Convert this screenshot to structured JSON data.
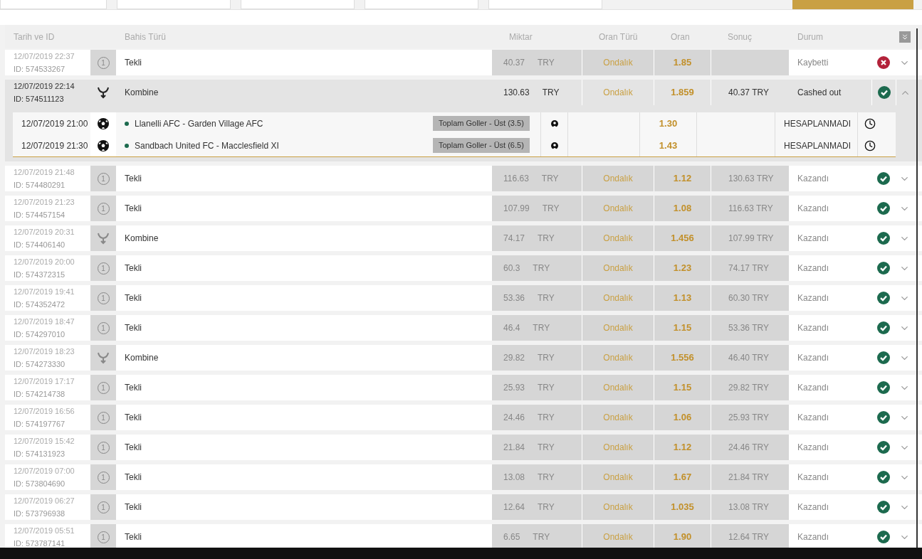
{
  "columns": [
    "Tarih ve ID",
    "Bahis Türü",
    "Miktar",
    "Oran Türü",
    "Oran",
    "Sonuç",
    "Durum"
  ],
  "bets": [
    {
      "date": "12/07/2019 22:37",
      "id": "ID: 574533267",
      "kind": "single",
      "badge": "1",
      "type": "Tekli",
      "amount": "40.37",
      "currency": "TRY",
      "odds_type": "Ondalık",
      "odds": "1.85",
      "status": "Kaybetti",
      "lost": true,
      "expanded": false
    },
    {
      "date": "12/07/2019 22:14",
      "id": "ID: 574511123",
      "kind": "combo",
      "type": "Kombine",
      "amount": "130.63",
      "currency": "TRY",
      "odds_type": "Ondalık",
      "odds": "1.859",
      "result": "40.37 TRY",
      "status": "Cashed out",
      "lost": false,
      "expanded": true,
      "selections": [
        {
          "date": "12/07/2019 21:00",
          "match": "Llanelli AFC - Garden Village AFC",
          "market": "Toplam Goller - Üst (3.5)",
          "odds": "1.30",
          "status": "HESAPLANMADI"
        },
        {
          "date": "12/07/2019 21:30",
          "match": "Sandbach United FC - Macclesfield XI",
          "market": "Toplam Goller - Üst (6.5)",
          "odds": "1.43",
          "status": "HESAPLANMADI"
        }
      ]
    },
    {
      "date": "12/07/2019 21:48",
      "id": "ID: 574480291",
      "kind": "single",
      "badge": "1",
      "type": "Tekli",
      "amount": "116.63",
      "currency": "TRY",
      "odds_type": "Ondalık",
      "odds": "1.12",
      "result": "130.63 TRY",
      "status": "Kazandı",
      "lost": false,
      "expanded": false
    },
    {
      "date": "12/07/2019 21:23",
      "id": "ID: 574457154",
      "kind": "single",
      "badge": "1",
      "type": "Tekli",
      "amount": "107.99",
      "currency": "TRY",
      "odds_type": "Ondalık",
      "odds": "1.08",
      "result": "116.63 TRY",
      "status": "Kazandı",
      "lost": false,
      "expanded": false
    },
    {
      "date": "12/07/2019 20:31",
      "id": "ID: 574406140",
      "kind": "combo",
      "type": "Kombine",
      "amount": "74.17",
      "currency": "TRY",
      "odds_type": "Ondalık",
      "odds": "1.456",
      "result": "107.99 TRY",
      "status": "Kazandı",
      "lost": false,
      "expanded": false
    },
    {
      "date": "12/07/2019 20:00",
      "id": "ID: 574372315",
      "kind": "single",
      "badge": "1",
      "type": "Tekli",
      "amount": "60.3",
      "currency": "TRY",
      "odds_type": "Ondalık",
      "odds": "1.23",
      "result": "74.17 TRY",
      "status": "Kazandı",
      "lost": false,
      "expanded": false
    },
    {
      "date": "12/07/2019 19:41",
      "id": "ID: 574352472",
      "kind": "single",
      "badge": "1",
      "type": "Tekli",
      "amount": "53.36",
      "currency": "TRY",
      "odds_type": "Ondalık",
      "odds": "1.13",
      "result": "60.30 TRY",
      "status": "Kazandı",
      "lost": false,
      "expanded": false
    },
    {
      "date": "12/07/2019 18:47",
      "id": "ID: 574297010",
      "kind": "single",
      "badge": "1",
      "type": "Tekli",
      "amount": "46.4",
      "currency": "TRY",
      "odds_type": "Ondalık",
      "odds": "1.15",
      "result": "53.36 TRY",
      "status": "Kazandı",
      "lost": false,
      "expanded": false
    },
    {
      "date": "12/07/2019 18:23",
      "id": "ID: 574273330",
      "kind": "combo",
      "type": "Kombine",
      "amount": "29.82",
      "currency": "TRY",
      "odds_type": "Ondalık",
      "odds": "1.556",
      "result": "46.40 TRY",
      "status": "Kazandı",
      "lost": false,
      "expanded": false
    },
    {
      "date": "12/07/2019 17:17",
      "id": "ID: 574214738",
      "kind": "single",
      "badge": "1",
      "type": "Tekli",
      "amount": "25.93",
      "currency": "TRY",
      "odds_type": "Ondalık",
      "odds": "1.15",
      "result": "29.82 TRY",
      "status": "Kazandı",
      "lost": false,
      "expanded": false
    },
    {
      "date": "12/07/2019 16:56",
      "id": "ID: 574197767",
      "kind": "single",
      "badge": "1",
      "type": "Tekli",
      "amount": "24.46",
      "currency": "TRY",
      "odds_type": "Ondalık",
      "odds": "1.06",
      "result": "25.93 TRY",
      "status": "Kazandı",
      "lost": false,
      "expanded": false
    },
    {
      "date": "12/07/2019 15:42",
      "id": "ID: 574131923",
      "kind": "single",
      "badge": "1",
      "type": "Tekli",
      "amount": "21.84",
      "currency": "TRY",
      "odds_type": "Ondalık",
      "odds": "1.12",
      "result": "24.46 TRY",
      "status": "Kazandı",
      "lost": false,
      "expanded": false
    },
    {
      "date": "12/07/2019 07:00",
      "id": "ID: 573804690",
      "kind": "single",
      "badge": "1",
      "type": "Tekli",
      "amount": "13.08",
      "currency": "TRY",
      "odds_type": "Ondalık",
      "odds": "1.67",
      "result": "21.84 TRY",
      "status": "Kazandı",
      "lost": false,
      "expanded": false
    },
    {
      "date": "12/07/2019 06:27",
      "id": "ID: 573796938",
      "kind": "single",
      "badge": "1",
      "type": "Tekli",
      "amount": "12.64",
      "currency": "TRY",
      "odds_type": "Ondalık",
      "odds": "1.035",
      "result": "13.08 TRY",
      "status": "Kazandı",
      "lost": false,
      "expanded": false
    },
    {
      "date": "12/07/2019 05:51",
      "id": "ID: 573787141",
      "kind": "single",
      "badge": "1",
      "type": "Tekli",
      "amount": "6.65",
      "currency": "TRY",
      "odds_type": "Ondalık",
      "odds": "1.90",
      "result": "12.64 TRY",
      "status": "Kazandı",
      "lost": false,
      "expanded": false
    }
  ]
}
